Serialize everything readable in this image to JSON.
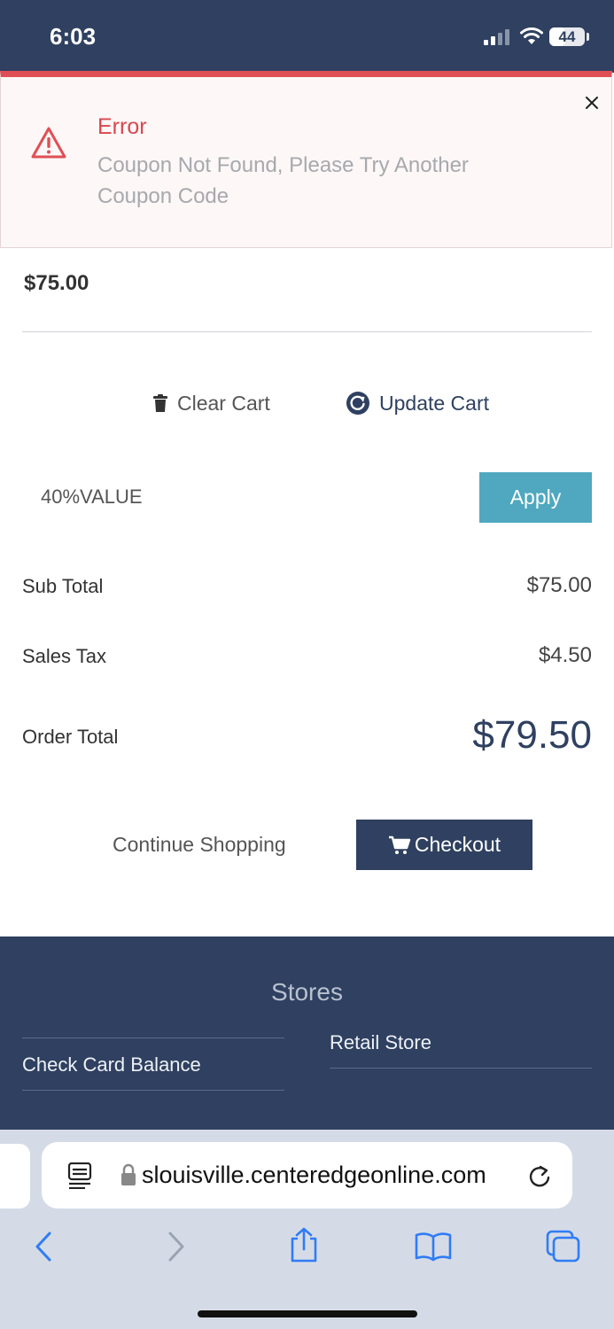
{
  "status_bar": {
    "time": "6:03",
    "battery": "44",
    "battery_level": 0.44
  },
  "toast": {
    "title": "Error",
    "message": "Coupon Not Found, Please Try Another Coupon Code",
    "icon": "warning-triangle-icon",
    "accent_color": "#df4f55"
  },
  "cart": {
    "item_price": "$75.00",
    "clear_label": "Clear Cart",
    "update_label": "Update Cart"
  },
  "coupon": {
    "value": "40%VALUE",
    "apply_label": "Apply"
  },
  "totals": {
    "subtotal_label": "Sub Total",
    "subtotal_value": "$75.00",
    "tax_label": "Sales Tax",
    "tax_value": "$4.50",
    "order_total_label": "Order Total",
    "order_total_value": "$79.50"
  },
  "actions": {
    "continue_label": "Continue Shopping",
    "checkout_label": "Checkout"
  },
  "footer": {
    "title": "Stores",
    "links": [
      "Check Card Balance",
      "Retail Store"
    ]
  },
  "browser": {
    "url": "slouisville.centeredgeonline.com"
  },
  "colors": {
    "navy": "#2f4060",
    "teal": "#4fa8bf",
    "error": "#df4f55"
  }
}
